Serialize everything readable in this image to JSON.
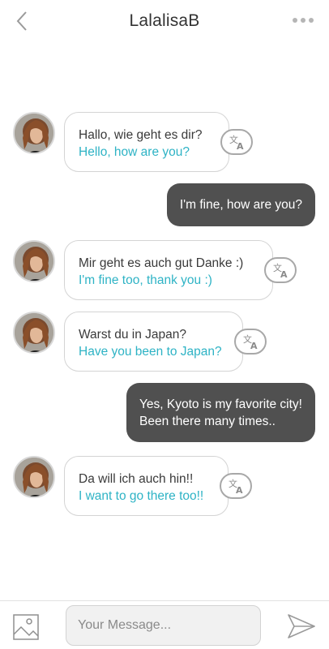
{
  "header": {
    "title": "LalalisaB",
    "back_icon": "chevron-left-icon",
    "more_icon": "more-dots-icon"
  },
  "colors": {
    "translation_text": "#2eb3c5",
    "outgoing_bubble": "#505050",
    "incoming_border": "#d4d4d4"
  },
  "messages": [
    {
      "direction": "incoming",
      "original": "Hallo, wie geht es dir?",
      "translation": "Hello, how are you?"
    },
    {
      "direction": "outgoing",
      "lines": [
        "I'm fine, how are you?"
      ]
    },
    {
      "direction": "incoming",
      "original": "Mir geht es auch gut Danke :)",
      "translation": "I'm fine too, thank you :)"
    },
    {
      "direction": "incoming",
      "original": "Warst du in Japan?",
      "translation": "Have you been to Japan?"
    },
    {
      "direction": "outgoing",
      "lines": [
        "Yes, Kyoto is my favorite city!",
        "Been there many times.."
      ]
    },
    {
      "direction": "incoming",
      "original": "Da will ich auch hin!!",
      "translation": "I want to go there too!!"
    }
  ],
  "composer": {
    "placeholder": "Your Message...",
    "value": "",
    "image_icon": "image-icon",
    "send_icon": "send-icon"
  }
}
